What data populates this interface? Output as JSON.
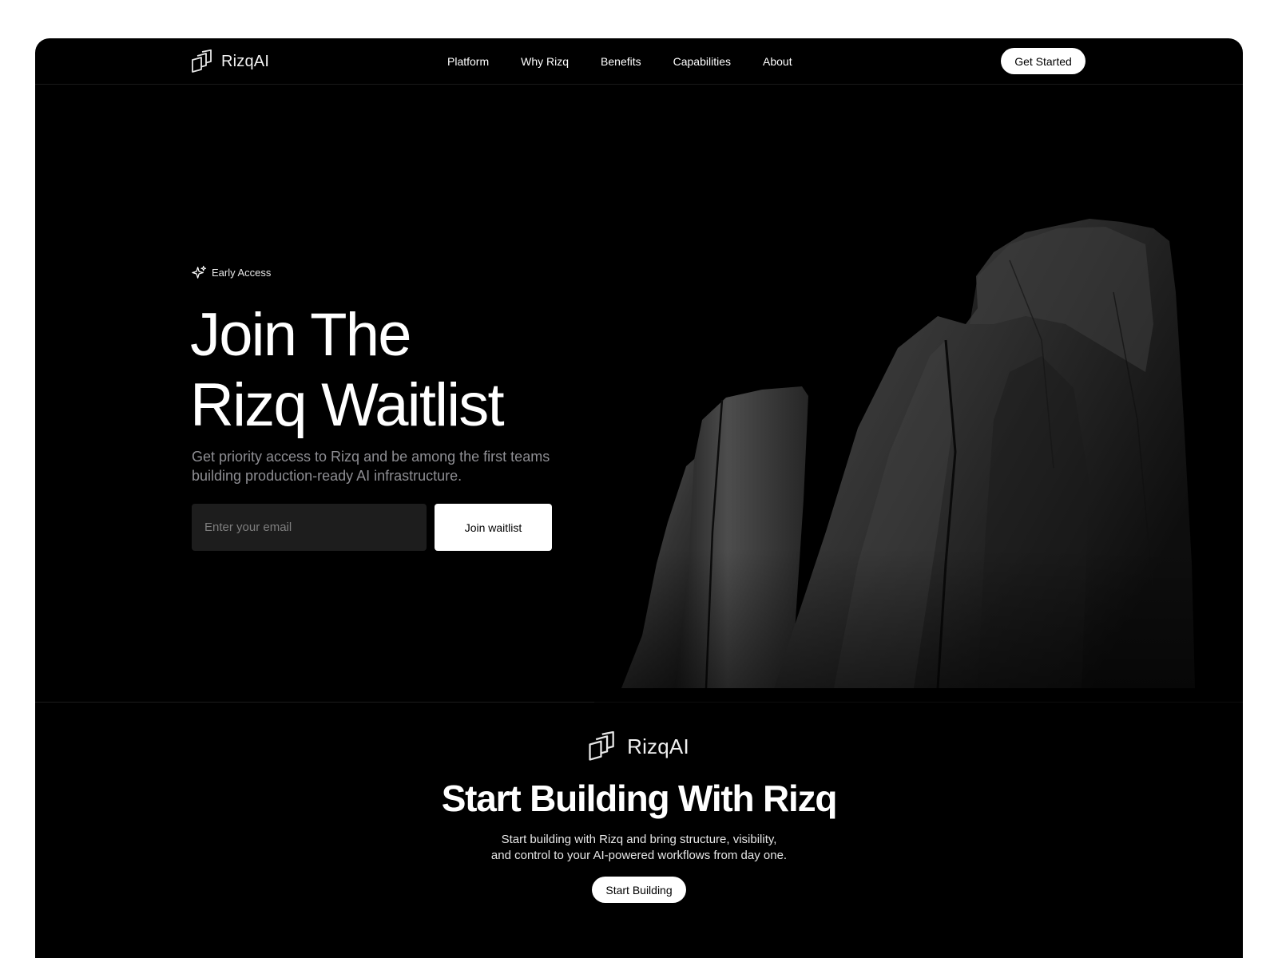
{
  "nav": {
    "brand": {
      "name": "RizqAI",
      "icon": "stacked-squares-logo-icon"
    },
    "links": [
      {
        "label": "Platform"
      },
      {
        "label": "Why Rizq"
      },
      {
        "label": "Benefits"
      },
      {
        "label": "Capabilities"
      },
      {
        "label": "About"
      }
    ],
    "cta_label": "Get Started"
  },
  "hero": {
    "badge": {
      "icon": "sparkle-icon",
      "label": "Early Access"
    },
    "title_lines": [
      "Join The",
      "Rizq Waitlist"
    ],
    "subtitle": "Get priority access to Rizq and be among the first teams building production-ready AI infrastructure.",
    "email_placeholder": "Enter your email",
    "email_value": "",
    "join_label": "Join waitlist",
    "image": "dark-rock-formation-image"
  },
  "cta": {
    "brand": {
      "name": "RizqAI",
      "icon": "stacked-squares-logo-icon"
    },
    "title": "Start Building With Rizq",
    "description_lines": [
      "Start building with Rizq and bring structure, visibility,",
      "and control to your AI-powered workflows from day one."
    ],
    "button_label": "Start Building"
  },
  "colors": {
    "page_background": "#ffffff",
    "frame_background": "#000000",
    "muted_text": "#8e8e93",
    "input_background": "#1d1d1d",
    "button_background": "#ffffff",
    "button_text": "#000000"
  }
}
